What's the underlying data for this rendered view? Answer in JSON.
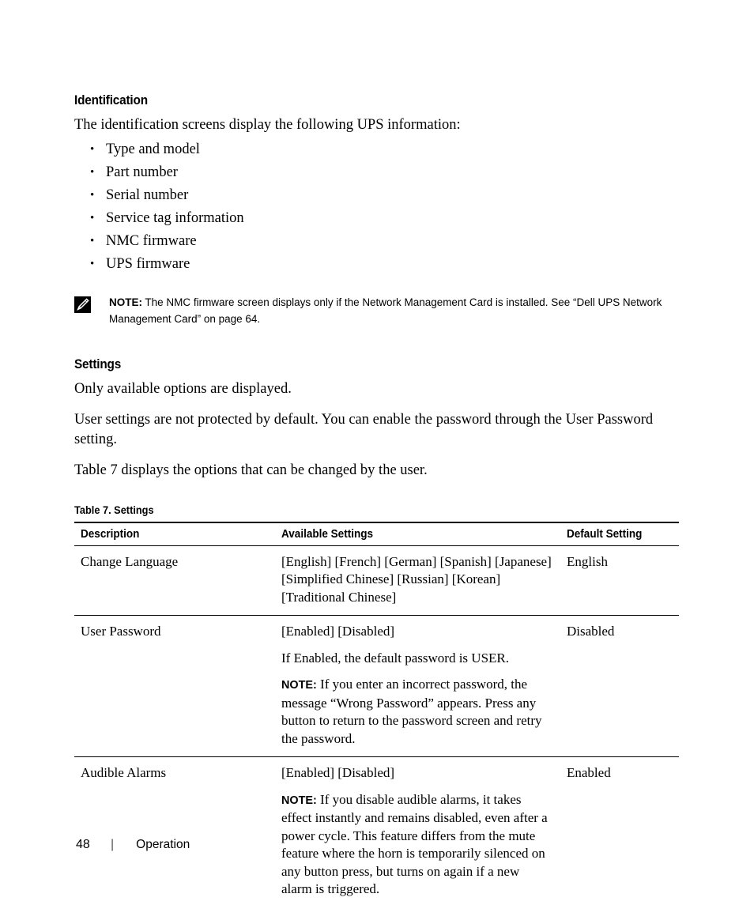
{
  "document": {
    "sections": [
      {
        "heading": "Identification",
        "intro": "The identification screens display the following UPS information:",
        "bullets": [
          "Type and model",
          "Part number",
          "Serial number",
          "Service tag information",
          "NMC firmware",
          "UPS firmware"
        ],
        "note": {
          "icon": "note-pencil-icon",
          "label": "NOTE:",
          "text": " The NMC firmware screen displays only if the Network Management Card is installed. See “Dell UPS Network Management Card” on page 64."
        }
      },
      {
        "heading": "Settings",
        "paragraphs": [
          "Only available options are displayed.",
          "User settings are not protected by default. You can enable the password through the User Password setting.",
          "Table 7 displays the options that can be changed by the user."
        ]
      }
    ],
    "table": {
      "caption": "Table 7. Settings",
      "headers": [
        "Description",
        "Available Settings",
        "Default Setting"
      ],
      "rows": [
        {
          "description": "Change Language",
          "available": [
            "[English] [French] [German] [Spanish] [Japanese] [Simplified Chinese] [Russian] [Korean] [Traditional Chinese]"
          ],
          "note_label": "",
          "note_text": "",
          "default": "English"
        },
        {
          "description": "User Password",
          "available": [
            "[Enabled] [Disabled]",
            "If Enabled, the default password is USER."
          ],
          "note_label": "NOTE:",
          "note_text": " If you enter an incorrect password, the message “Wrong Password” appears. Press any button to return to the password screen and retry the password.",
          "default": "Disabled"
        },
        {
          "description": "Audible Alarms",
          "available": [
            "[Enabled] [Disabled]"
          ],
          "note_label": "NOTE:",
          "note_text": " If you disable audible alarms, it takes effect instantly and remains disabled, even after a power cycle. This feature differs from the mute feature where the horn is temporarily silenced on any button press, but turns on again if a new alarm is triggered.",
          "default": "Enabled"
        }
      ]
    },
    "footer": {
      "page_number": "48",
      "separator": "|",
      "chapter": "Operation"
    },
    "colors": {
      "text": "#000000",
      "background": "#ffffff",
      "rule": "#000000"
    }
  }
}
